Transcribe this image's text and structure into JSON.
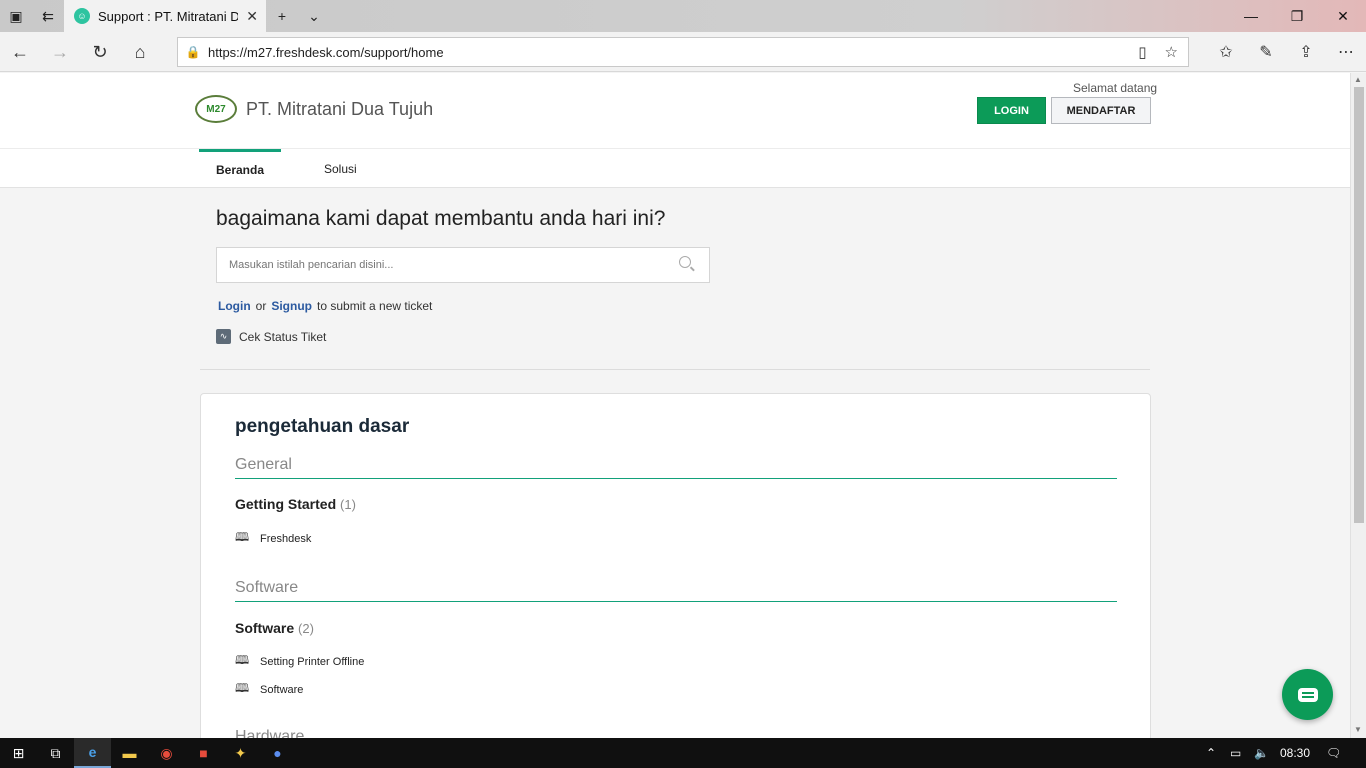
{
  "browser": {
    "tab_title": "Support : PT. Mitratani Dua Tujuh",
    "url": "https://m27.freshdesk.com/support/home"
  },
  "header": {
    "logo_text": "M27",
    "brand": "PT. Mitratani Dua Tujuh",
    "welcome": "Selamat datang",
    "login_label": "LOGIN",
    "signup_label": "MENDAFTAR"
  },
  "nav": {
    "tabs": [
      {
        "label": "Beranda"
      },
      {
        "label": "Solusi"
      }
    ]
  },
  "hero": {
    "title": "bagaimana kami dapat membantu anda hari ini?",
    "search_placeholder": "Masukan istilah pencarian disini...",
    "login_link": "Login",
    "or_text": "or",
    "signup_link": "Signup",
    "submit_text": "to submit a new ticket",
    "status_label": "Cek Status Tiket"
  },
  "kb": {
    "title": "pengetahuan dasar",
    "categories": [
      {
        "name": "General",
        "folders": [
          {
            "name": "Getting Started",
            "count": "(1)",
            "articles": [
              "Freshdesk"
            ]
          }
        ]
      },
      {
        "name": "Software",
        "folders": [
          {
            "name": "Software",
            "count": "(2)",
            "articles": [
              "Setting Printer Offline",
              "Software"
            ]
          }
        ]
      },
      {
        "name": "Hardware",
        "folders": []
      }
    ]
  },
  "taskbar": {
    "clock": "08:30"
  },
  "colors": {
    "accent": "#12a17a",
    "login_green": "#0c9b58",
    "link_blue": "#2c5aa0"
  }
}
